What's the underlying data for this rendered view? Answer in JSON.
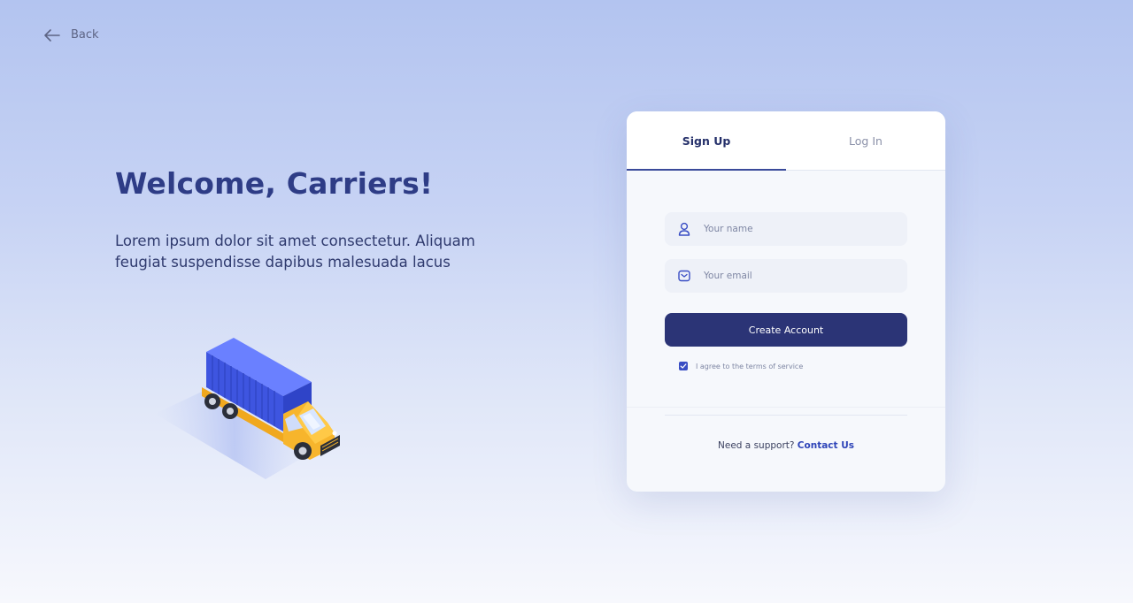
{
  "nav": {
    "back_label": "Back"
  },
  "hero": {
    "title": "Welcome, Carriers!",
    "subtitle": "Lorem ipsum dolor sit amet consectetur. Aliquam feugiat suspendisse dapibus malesuada lacus"
  },
  "auth": {
    "tabs": [
      {
        "label": "Sign Up",
        "active": true
      },
      {
        "label": "Log In",
        "active": false
      }
    ],
    "name_field": {
      "placeholder": "Your name",
      "value": "",
      "icon": "user-icon"
    },
    "email_field": {
      "placeholder": "Your email",
      "value": "",
      "icon": "mail-icon"
    },
    "submit_label": "Create Account",
    "terms": {
      "label": "I agree to the terms of service",
      "checked": true
    },
    "support": {
      "prompt": "Need a support?",
      "link_label": "Contact Us"
    }
  },
  "colors": {
    "primary": "#2b3476",
    "accent": "#3a4ec4",
    "title": "#2e3c86",
    "truck_body": "#f7b52c",
    "container": "#4a63f0"
  }
}
